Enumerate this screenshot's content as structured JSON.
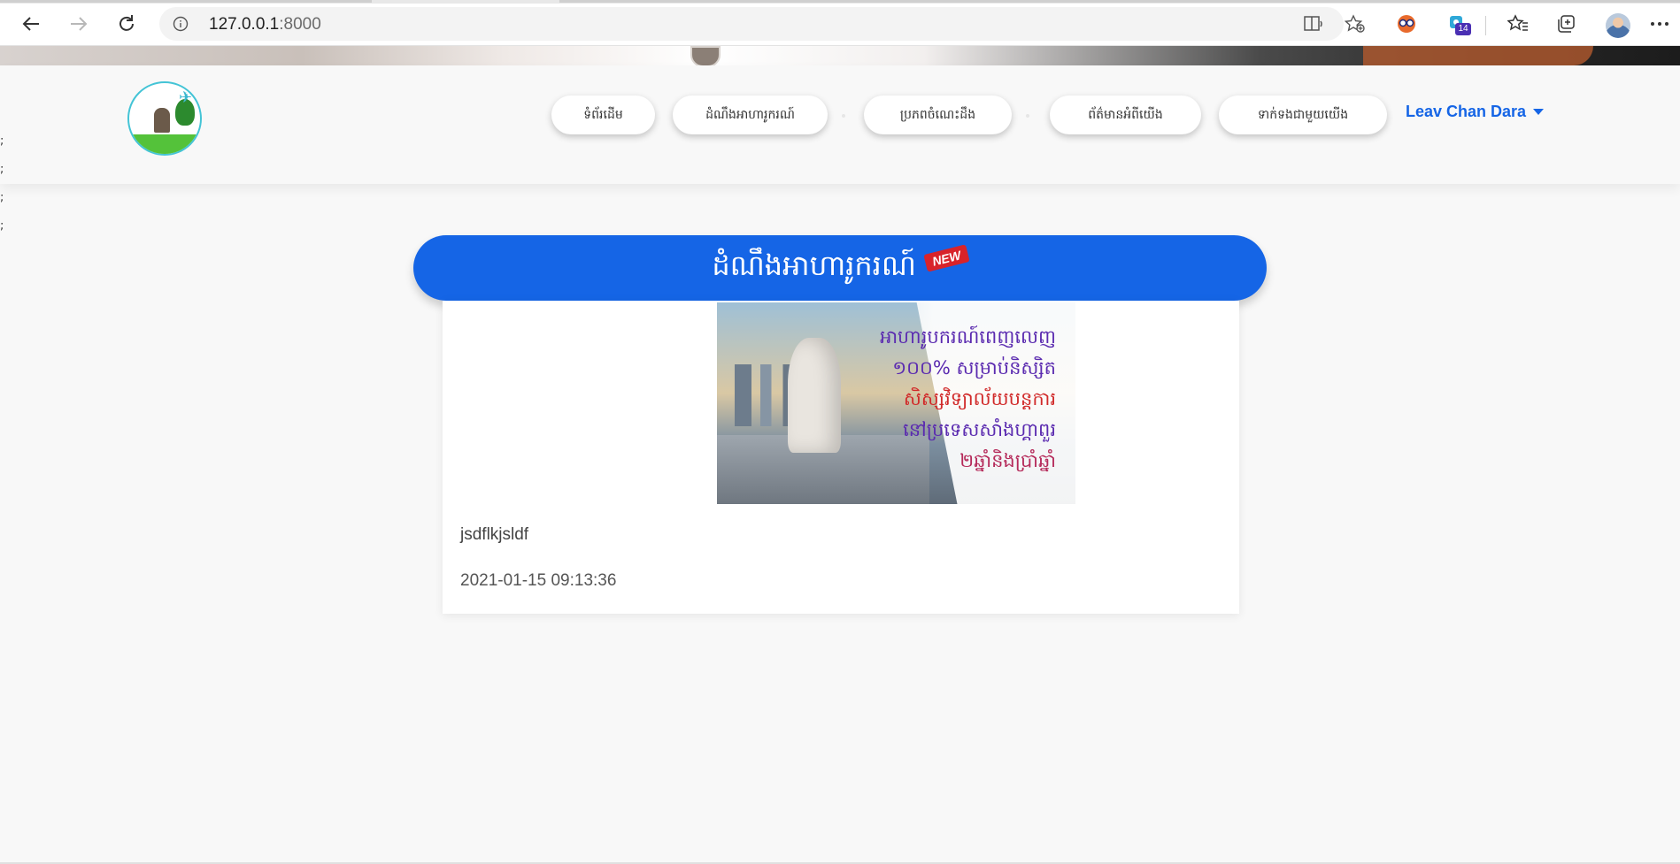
{
  "browser": {
    "url_host": "127.0.0.1",
    "url_port": ":8000",
    "extension_badge": "14"
  },
  "nav": {
    "items": [
      {
        "label": "ទំព័រដើម"
      },
      {
        "label": "ដំណឹងអាហារូករណ៍"
      },
      {
        "label": "ប្រភពចំណេះដឹង"
      },
      {
        "label": "ព័ត៌មានអំពីយើង"
      },
      {
        "label": "ទាក់ទងជាមួយយើង"
      }
    ],
    "user_name": "Leav Chan Dara"
  },
  "stray_text": [
    ";",
    ";",
    ";",
    ";"
  ],
  "section": {
    "title": "ដំណឹងអាហារូករណ៍",
    "badge": "NEW"
  },
  "post": {
    "image_lines": [
      "អាហារូបករណ៍ពេញលេញ",
      "១០០% សម្រាប់និស្សិត",
      "សិស្សវិទ្យាល័យបន្តការ",
      "នៅប្រទេសសាំងហ្គាពួរ",
      "២ឆ្នាំនិងប្រាំឆ្នាំ"
    ],
    "text": "jsdflkjsldf",
    "date": "2021-01-15 09:13:36"
  },
  "colors": {
    "accent": "#1565e6",
    "page_bg": "#f8f8f8",
    "badge_red": "#d8232a"
  }
}
